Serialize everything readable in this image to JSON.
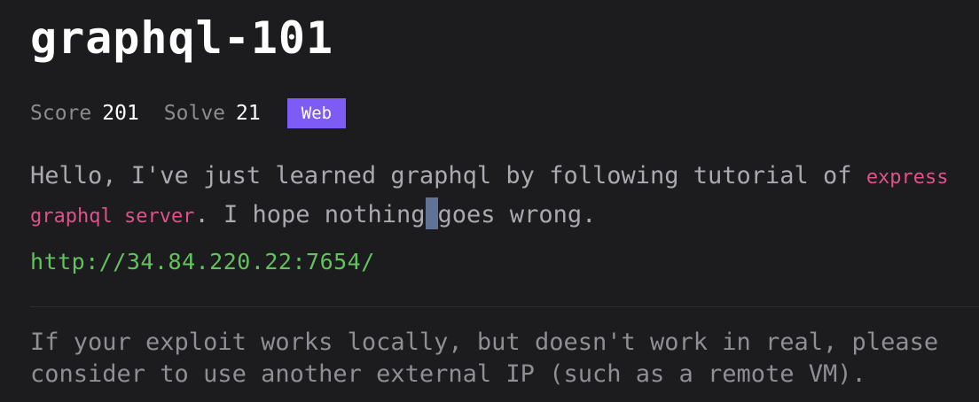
{
  "challenge": {
    "title": "graphql-101",
    "score_label": "Score",
    "score_value": "201",
    "solve_label": "Solve",
    "solve_value": "21",
    "category": "Web",
    "description": {
      "part1": "Hello, I've just learned graphql by following tutorial of ",
      "code": "express graphql server",
      "part2": ". I hope nothing",
      "part3": "goes wrong."
    },
    "link": "http://34.84.220.22:7654/",
    "note": "If your exploit works locally, but doesn't work in real, please consider to use another external IP (such as a remote VM)."
  },
  "colors": {
    "background": "#1c1c1e",
    "badge": "#7c5cf5",
    "code": "#e0508a",
    "link": "#62c35d"
  }
}
